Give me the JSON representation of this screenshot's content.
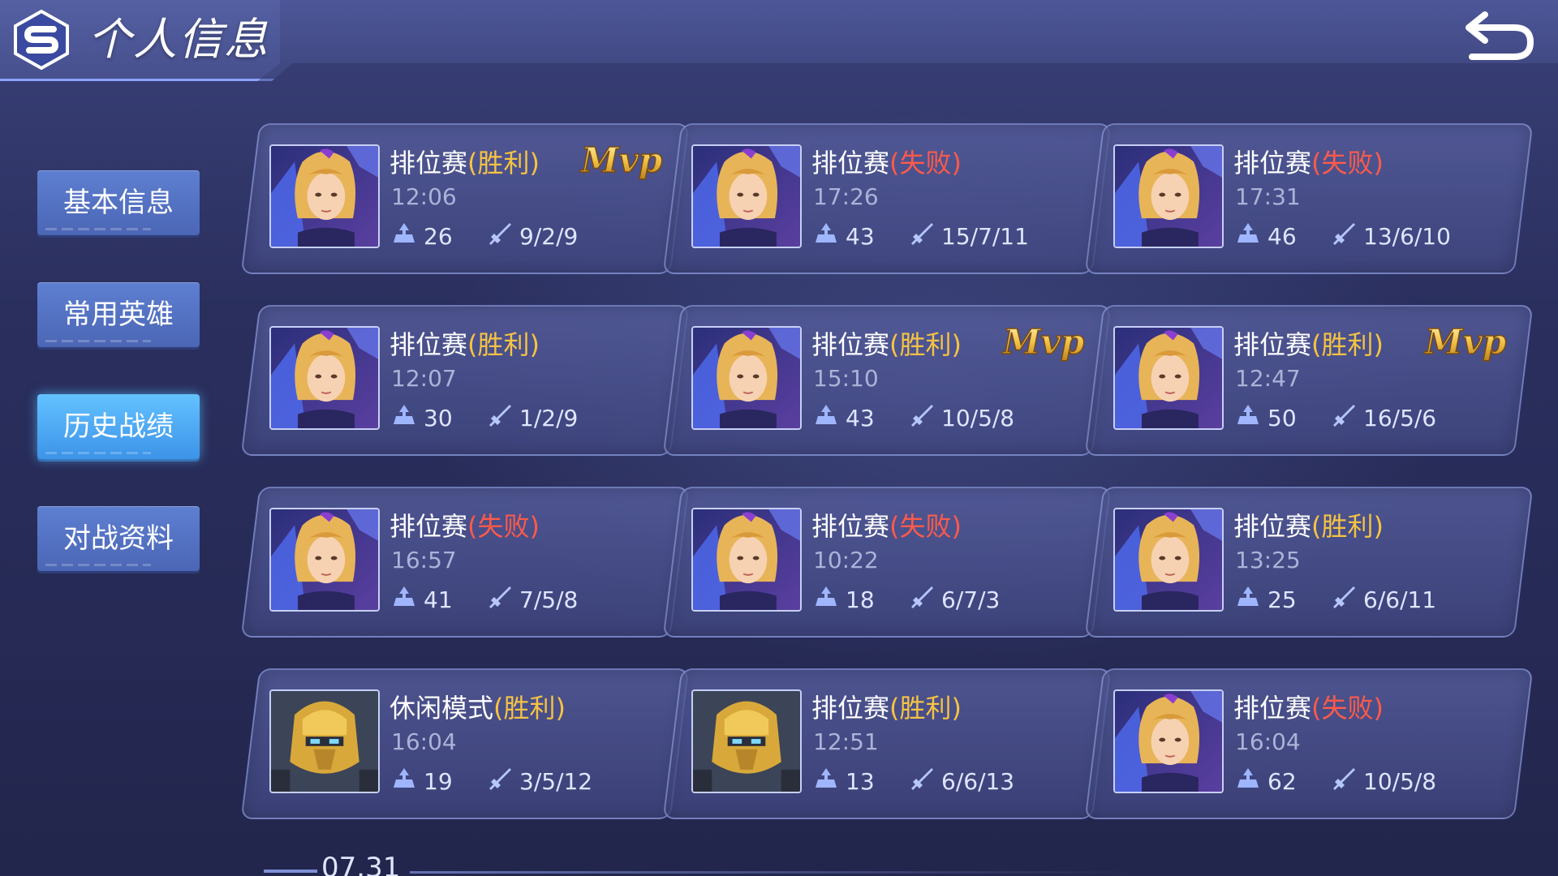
{
  "header": {
    "title": "个人信息",
    "logo_icon": "s-logo-icon",
    "back_icon": "back-arrow-icon"
  },
  "sidebar": {
    "items": [
      {
        "label": "基本信息",
        "active": false
      },
      {
        "label": "常用英雄",
        "active": false
      },
      {
        "label": "历史战绩",
        "active": true
      },
      {
        "label": "对战资料",
        "active": false
      }
    ]
  },
  "colors": {
    "win": "#f6c343",
    "lose": "#ff5a4a",
    "active_tab": "#4fb0ff"
  },
  "matches": [
    {
      "mode": "排位赛",
      "result": "(胜利)",
      "win": true,
      "time": "12:06",
      "score": "26",
      "kda": "9/2/9",
      "mvp": true,
      "hero": "blonde-heroine"
    },
    {
      "mode": "排位赛",
      "result": "(失败)",
      "win": false,
      "time": "17:26",
      "score": "43",
      "kda": "15/7/11",
      "mvp": false,
      "hero": "blonde-heroine"
    },
    {
      "mode": "排位赛",
      "result": "(失败)",
      "win": false,
      "time": "17:31",
      "score": "46",
      "kda": "13/6/10",
      "mvp": false,
      "hero": "blonde-heroine"
    },
    {
      "mode": "排位赛",
      "result": "(胜利)",
      "win": true,
      "time": "12:07",
      "score": "30",
      "kda": "1/2/9",
      "mvp": false,
      "hero": "blonde-heroine"
    },
    {
      "mode": "排位赛",
      "result": "(胜利)",
      "win": true,
      "time": "15:10",
      "score": "43",
      "kda": "10/5/8",
      "mvp": true,
      "hero": "blonde-heroine"
    },
    {
      "mode": "排位赛",
      "result": "(胜利)",
      "win": true,
      "time": "12:47",
      "score": "50",
      "kda": "16/5/6",
      "mvp": true,
      "hero": "blonde-heroine"
    },
    {
      "mode": "排位赛",
      "result": "(失败)",
      "win": false,
      "time": "16:57",
      "score": "41",
      "kda": "7/5/8",
      "mvp": false,
      "hero": "blonde-heroine"
    },
    {
      "mode": "排位赛",
      "result": "(失败)",
      "win": false,
      "time": "10:22",
      "score": "18",
      "kda": "6/7/3",
      "mvp": false,
      "hero": "blonde-heroine"
    },
    {
      "mode": "排位赛",
      "result": "(胜利)",
      "win": true,
      "time": "13:25",
      "score": "25",
      "kda": "6/6/11",
      "mvp": false,
      "hero": "blonde-heroine"
    },
    {
      "mode": "休闲模式",
      "result": "(胜利)",
      "win": true,
      "time": "16:04",
      "score": "19",
      "kda": "3/5/12",
      "mvp": false,
      "hero": "gold-robot"
    },
    {
      "mode": "排位赛",
      "result": "(胜利)",
      "win": true,
      "time": "12:51",
      "score": "13",
      "kda": "6/6/13",
      "mvp": false,
      "hero": "gold-robot"
    },
    {
      "mode": "排位赛",
      "result": "(失败)",
      "win": false,
      "time": "16:04",
      "score": "62",
      "kda": "10/5/8",
      "mvp": false,
      "hero": "blonde-heroine"
    }
  ],
  "mvp_label": "Mvp",
  "date_divider": "07.31"
}
